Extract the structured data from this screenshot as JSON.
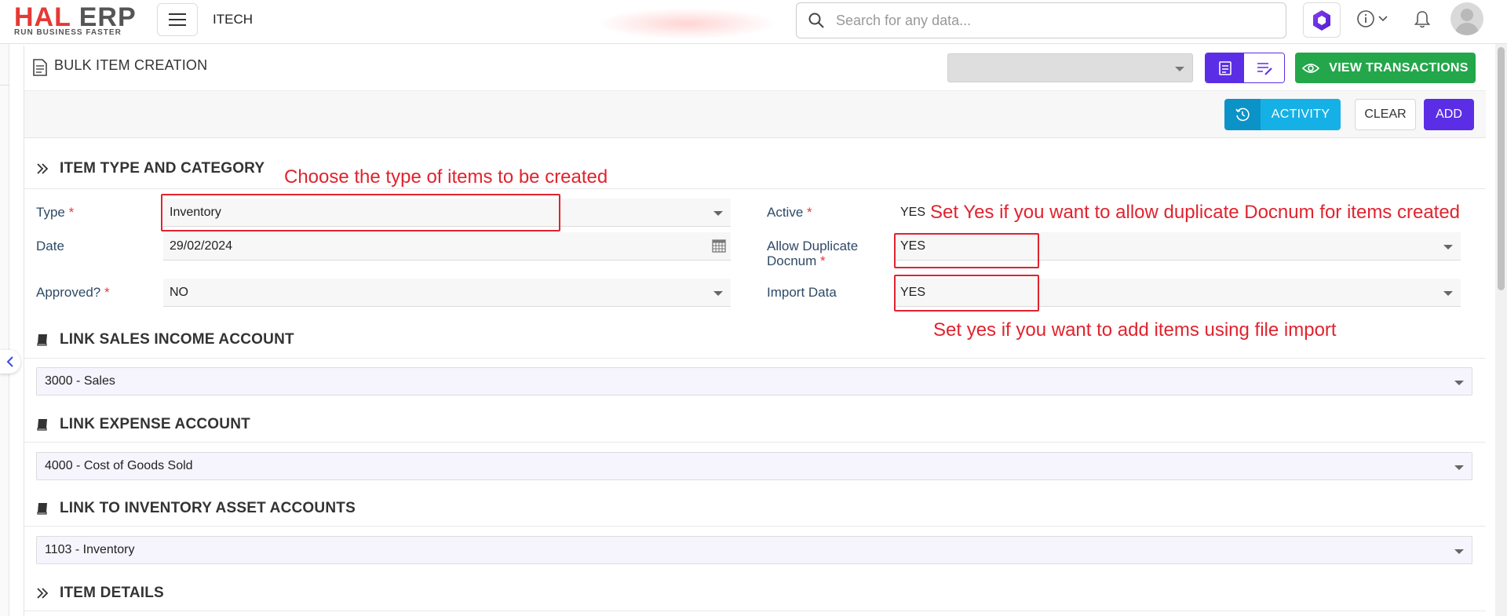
{
  "app": {
    "logo_main_1": "HAL",
    "logo_main_2": "ERP",
    "logo_tagline": "RUN BUSINESS FASTER",
    "company": "ITECH",
    "search_placeholder": "Search for any data..."
  },
  "page": {
    "title": "BULK ITEM CREATION",
    "view_transactions_label": "VIEW TRANSACTIONS",
    "activity_label": "ACTIVITY",
    "clear_label": "CLEAR",
    "add_label": "ADD"
  },
  "sections": {
    "item_type": "ITEM TYPE AND CATEGORY",
    "sales_income": "LINK SALES INCOME ACCOUNT",
    "expense": "LINK EXPENSE ACCOUNT",
    "inventory_asset": "LINK TO INVENTORY ASSET ACCOUNTS",
    "item_details": "ITEM DETAILS"
  },
  "fields": {
    "type": {
      "label": "Type",
      "value": "Inventory"
    },
    "date": {
      "label": "Date",
      "value": "29/02/2024"
    },
    "approved": {
      "label": "Approved?",
      "value": "NO"
    },
    "active": {
      "label": "Active",
      "value": "YES"
    },
    "allow_duplicate": {
      "label_line1": "Allow Duplicate",
      "label_line2": "Docnum",
      "value": "YES"
    },
    "import_data": {
      "label": "Import Data",
      "value": "YES"
    },
    "required_mark": "*"
  },
  "accounts": {
    "sales_income": "3000 - Sales",
    "expense": "4000 - Cost of Goods Sold",
    "inventory_asset": "1103 - Inventory"
  },
  "annotations": {
    "type_note": "Choose the type of items to be created",
    "duplicate_note": "Set Yes if you want to allow duplicate Docnum for items created",
    "import_note": "Set yes if you want to add items using file import"
  },
  "colors": {
    "primary": "#5b2ee6",
    "success": "#23a74a",
    "info": "#15b1e6",
    "annotation": "#e0232e"
  }
}
